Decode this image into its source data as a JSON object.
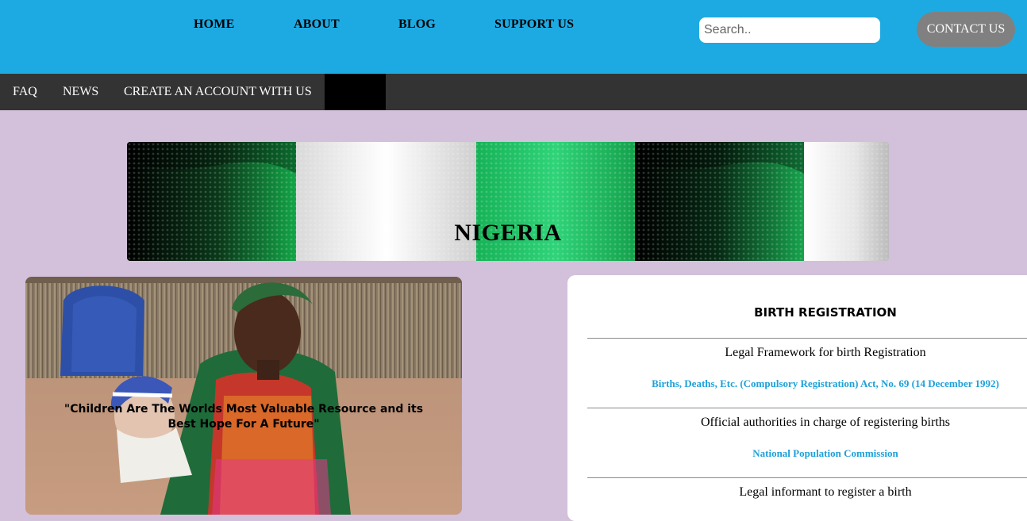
{
  "header": {
    "nav": [
      "HOME",
      "ABOUT",
      "BLOG",
      "SUPPORT US"
    ],
    "search_placeholder": "Search..",
    "contact_label": "CONTACT US"
  },
  "subnav": [
    "FAQ",
    "NEWS",
    "CREATE AN ACCOUNT WITH US"
  ],
  "banner": {
    "title": "NIGERIA"
  },
  "photo": {
    "quote": "\"Children Are The Worlds Most Valuable Resource and its Best Hope For A Future\""
  },
  "card": {
    "heading": "BIRTH REGISTRATION",
    "rows": [
      {
        "label": "Legal Framework for birth Registration",
        "link": "Births, Deaths, Etc. (Compulsory Registration) Act, No. 69 (14 December 1992)"
      },
      {
        "label": "Official authorities in charge of registering births",
        "link": "National Population Commission"
      },
      {
        "label": "Legal informant to register a birth",
        "link": ""
      }
    ]
  },
  "colors": {
    "header_bg": "#1daae2",
    "subnav_bg": "#333333",
    "page_bg": "#d3c0da",
    "link": "#1ea1d9",
    "flag_green": "#1aa84f"
  }
}
